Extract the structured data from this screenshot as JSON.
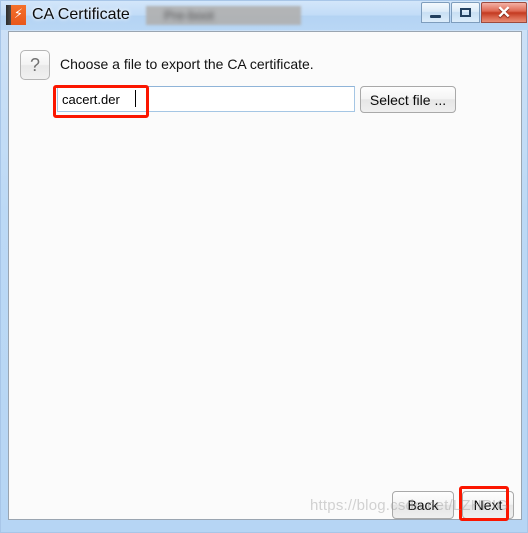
{
  "window": {
    "title": "CA Certificate",
    "title_redacted_text": "Pre-boot",
    "app_icon": "app-certificate-icon",
    "controls": {
      "minimize_label": "minimize-icon",
      "maximize_label": "maximize-icon",
      "close_label": "✕"
    }
  },
  "content": {
    "help_button_label": "?",
    "instruction": "Choose a file to export the CA certificate.",
    "file_field": {
      "value": "cacert.der",
      "placeholder": ""
    },
    "select_file_label": "Select file ..."
  },
  "footer": {
    "back_label": "Back",
    "next_label": "Next"
  },
  "watermark": {
    "text": "https://blog.csdn.net/LZHPIG"
  },
  "colors": {
    "titlebar_blue": "#bcd9f5",
    "annotation_red": "#fb1600",
    "close_button_red": "#c33a21",
    "app_icon_orange": "#e8571b",
    "content_background": "#fbfbfb",
    "input_border_blue": "#a5c6e4"
  },
  "annotations": [
    {
      "name": "filename-highlight",
      "target": "file-input"
    },
    {
      "name": "next-highlight",
      "target": "next-button"
    }
  ]
}
